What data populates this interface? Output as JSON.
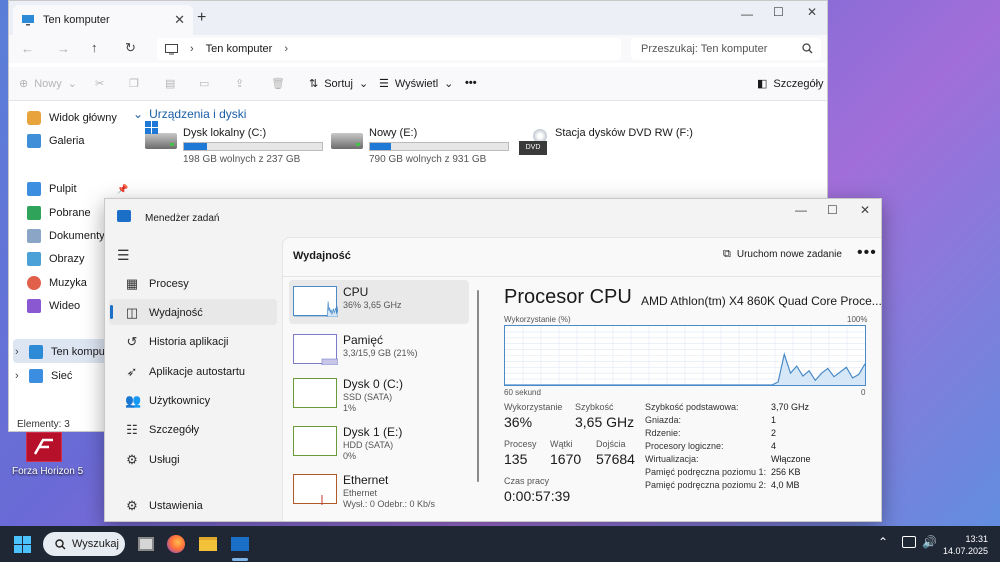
{
  "desktop": {
    "icon_label": "Forza Horizon 5"
  },
  "explorer": {
    "tab_title": "Ten komputer",
    "address": "Ten komputer",
    "search_placeholder": "Przeszukaj: Ten komputer",
    "toolbar": {
      "new": "Nowy",
      "sort": "Sortuj",
      "view": "Wyświetl",
      "more": "•••",
      "details": "Szczegóły"
    },
    "nav": [
      "Widok główny",
      "Galeria",
      "Pulpit",
      "Pobrane",
      "Dokumenty",
      "Obrazy",
      "Muzyka",
      "Wideo",
      "Ten komputer",
      "Sieć"
    ],
    "section_title": "Urządzenia i dyski",
    "drives": [
      {
        "name": "Dysk lokalny (C:)",
        "free": "198 GB wolnych z 237 GB",
        "used_pct": 16.5
      },
      {
        "name": "Nowy (E:)",
        "free": "790 GB wolnych z 931 GB",
        "used_pct": 15.1
      },
      {
        "name": "Stacja dysków DVD RW (F:)",
        "badge": "DVD"
      }
    ],
    "status": "Elementy: 3"
  },
  "taskmgr": {
    "title": "Menedżer zadań",
    "sidebar": [
      "Procesy",
      "Wydajność",
      "Historia aplikacji",
      "Aplikacje autostartu",
      "Użytkownicy",
      "Szczegóły",
      "Usługi",
      "Ustawienia"
    ],
    "heading": "Wydajność",
    "run_task": "Uruchom nowe zadanie",
    "more": "•••",
    "devices": [
      {
        "name": "CPU",
        "l1": "36% 3,65 GHz",
        "l2": ""
      },
      {
        "name": "Pamięć",
        "l1": "3,3/15,9 GB (21%)",
        "l2": ""
      },
      {
        "name": "Dysk 0 (C:)",
        "l1": "SSD (SATA)",
        "l2": "1%"
      },
      {
        "name": "Dysk 1 (E:)",
        "l1": "HDD (SATA)",
        "l2": "0%"
      },
      {
        "name": "Ethernet",
        "l1": "Ethernet",
        "l2": "Wysł.: 0 Odebr.: 0 Kb/s"
      }
    ],
    "cpu": {
      "title": "Procesor CPU",
      "model": "AMD Athlon(tm) X4 860K Quad Core Proce...",
      "y_label": "Wykorzystanie (%)",
      "y_max": "100%",
      "x_left": "60 sekund",
      "x_right": "0",
      "stats": {
        "util_label": "Wykorzystanie",
        "util": "36%",
        "speed_label": "Szybkość",
        "speed": "3,65 GHz",
        "proc_label": "Procesy",
        "proc": "135",
        "threads_label": "Wątki",
        "threads": "1670",
        "handles_label": "Dojścia",
        "handles": "57684",
        "uptime_label": "Czas pracy",
        "uptime": "0:00:57:39"
      },
      "specs": [
        {
          "k": "Szybkość podstawowa:",
          "v": "3,70 GHz"
        },
        {
          "k": "Gniazda:",
          "v": "1"
        },
        {
          "k": "Rdzenie:",
          "v": "2"
        },
        {
          "k": "Procesory logiczne:",
          "v": "4"
        },
        {
          "k": "Wirtualizacja:",
          "v": "Włączone"
        },
        {
          "k": "Pamięć podręczna poziomu 1:",
          "v": "256 KB"
        },
        {
          "k": "Pamięć podręczna poziomu 2:",
          "v": "4,0 MB"
        }
      ],
      "graph_values": [
        0,
        0,
        0,
        0,
        0,
        0,
        0,
        0,
        0,
        0,
        0,
        0,
        0,
        0,
        0,
        0,
        0,
        0,
        0,
        0,
        0,
        0,
        0,
        0,
        0,
        0,
        0,
        0,
        0,
        0,
        0,
        0,
        0,
        0,
        0,
        0,
        0,
        0,
        0,
        0,
        0,
        0,
        0,
        0,
        5,
        52,
        20,
        32,
        15,
        24,
        8,
        20,
        28,
        14,
        22,
        30,
        12,
        18,
        36
      ]
    }
  },
  "taskbar": {
    "search": "Wyszukaj",
    "time": "13:31",
    "date": "14.07.2025"
  },
  "colors": {
    "accent": "#1b6fc6",
    "cpu_graph": "#4a8ac8"
  }
}
